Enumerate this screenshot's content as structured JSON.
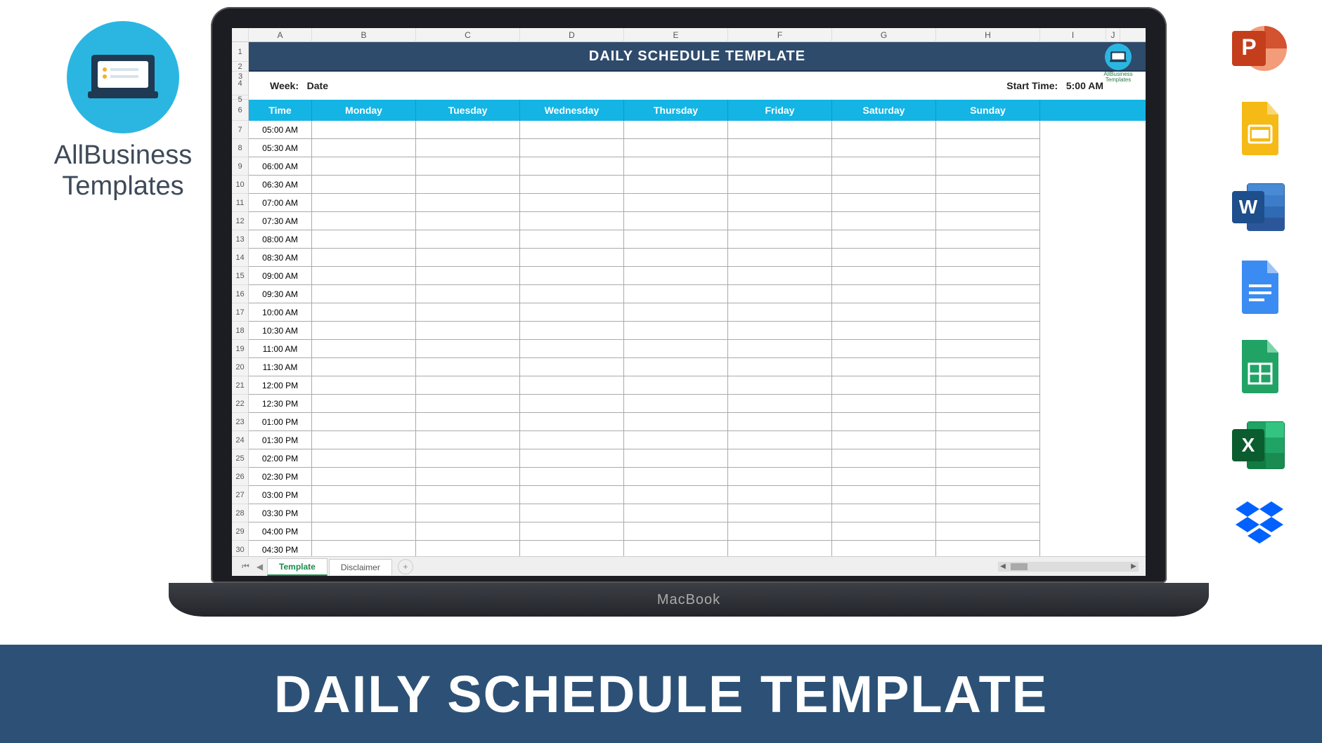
{
  "brand": {
    "line1": "AllBusiness",
    "line2": "Templates"
  },
  "spreadsheet": {
    "columns": [
      "A",
      "B",
      "C",
      "D",
      "E",
      "F",
      "G",
      "H",
      "I",
      "J"
    ],
    "title": "DAILY SCHEDULE TEMPLATE",
    "week_label": "Week:",
    "week_value": "Date",
    "start_label": "Start Time:",
    "start_value": "5:00 AM",
    "headers": [
      "Time",
      "Monday",
      "Tuesday",
      "Wednesday",
      "Thursday",
      "Friday",
      "Saturday",
      "Sunday"
    ],
    "times": [
      "05:00 AM",
      "05:30 AM",
      "06:00 AM",
      "06:30 AM",
      "07:00 AM",
      "07:30 AM",
      "08:00 AM",
      "08:30 AM",
      "09:00 AM",
      "09:30 AM",
      "10:00 AM",
      "10:30 AM",
      "11:00 AM",
      "11:30 AM",
      "12:00 PM",
      "12:30 PM",
      "01:00 PM",
      "01:30 PM",
      "02:00 PM",
      "02:30 PM",
      "03:00 PM",
      "03:30 PM",
      "04:00 PM",
      "04:30 PM"
    ],
    "row_numbers_header": [
      "1",
      "2",
      "3",
      "4",
      "5",
      "6"
    ],
    "tabs": {
      "active": "Template",
      "other": "Disclaimer"
    },
    "corner_logo_text": "AllBusiness\nTemplates"
  },
  "laptop_label": "MacBook",
  "banner_text": "DAILY SCHEDULE TEMPLATE",
  "app_icons": [
    "powerpoint-icon",
    "google-slides-icon",
    "word-icon",
    "google-docs-icon",
    "google-sheets-icon",
    "excel-icon",
    "dropbox-icon"
  ]
}
